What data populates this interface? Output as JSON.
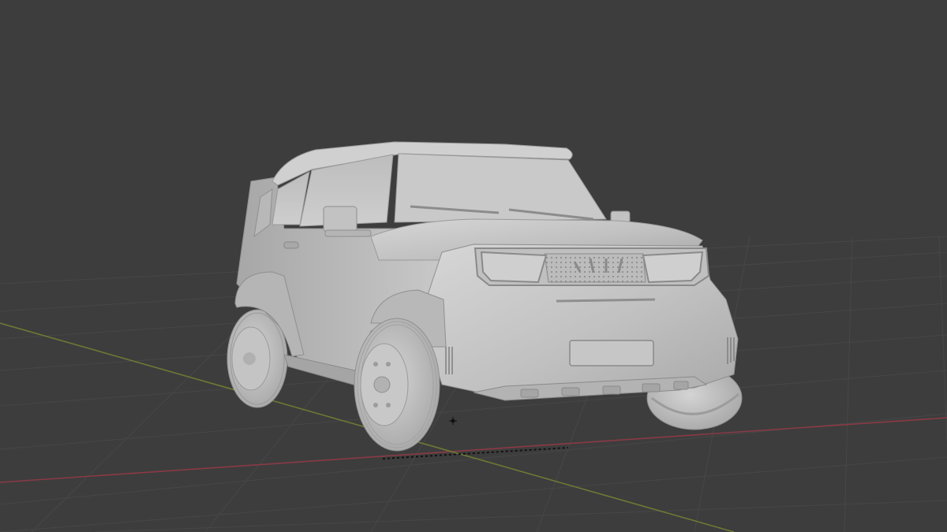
{
  "viewport": {
    "background_color": "#3d3d3d",
    "shading_mode": "solid"
  },
  "grid": {
    "visible": true,
    "line_color": "#474747",
    "x_axis_color": "#8a3a45",
    "y_axis_color": "#6c7a35"
  },
  "model": {
    "object_type": "compact SUV mesh",
    "material_color": "#c4c4c4",
    "shadow_color": "#8f8f8f",
    "highlight_color": "#dadada"
  },
  "cursor": {
    "icon": "3d-cursor-icon",
    "color": "#111111"
  }
}
